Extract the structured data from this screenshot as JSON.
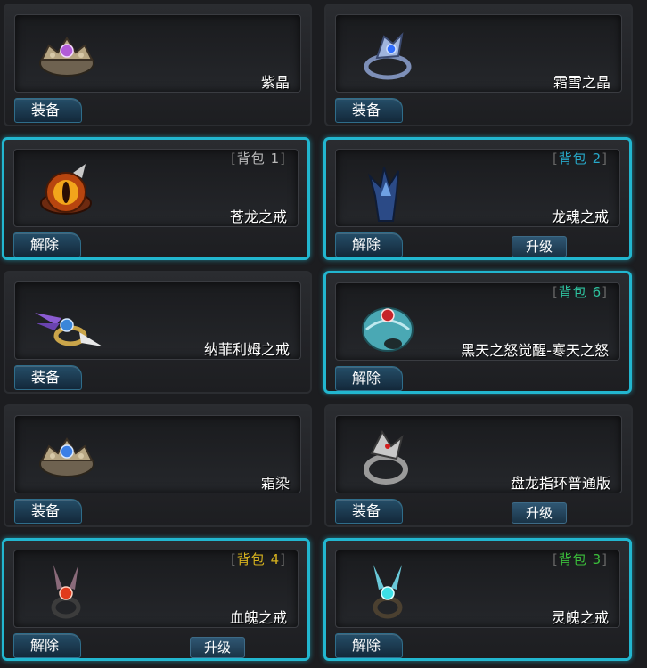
{
  "items": [
    {
      "name": "紫晶",
      "button": "装备",
      "selected": false,
      "bag": null,
      "upgrade": null,
      "icon": "crown-ring-purple-icon"
    },
    {
      "name": "霜雪之晶",
      "button": "装备",
      "selected": false,
      "bag": null,
      "upgrade": null,
      "icon": "frost-ring-icon"
    },
    {
      "name": "苍龙之戒",
      "button": "解除",
      "selected": true,
      "bag": {
        "label": "背包",
        "num": "1",
        "color": "#b8b8b8"
      },
      "upgrade": null,
      "icon": "dragon-eye-ring-icon"
    },
    {
      "name": "龙魂之戒",
      "button": "解除",
      "selected": true,
      "bag": {
        "label": "背包",
        "num": "2",
        "color": "#27a9c9"
      },
      "upgrade": "升级",
      "icon": "blue-claw-ring-icon"
    },
    {
      "name": "纳菲利姆之戒",
      "button": "装备",
      "selected": false,
      "bag": null,
      "upgrade": null,
      "icon": "winged-ring-icon"
    },
    {
      "name": "黑天之怒觉醒-寒天之怒",
      "button": "解除",
      "selected": true,
      "bag": {
        "label": "背包",
        "num": "6",
        "color": "#2ec4a0"
      },
      "upgrade": null,
      "icon": "ice-orb-ring-icon"
    },
    {
      "name": "霜染",
      "button": "装备",
      "selected": false,
      "bag": null,
      "upgrade": null,
      "icon": "crown-ring-blue-icon"
    },
    {
      "name": "盘龙指环普通版",
      "button": "装备",
      "selected": false,
      "bag": null,
      "upgrade": "升级",
      "icon": "silver-dragon-ring-icon"
    },
    {
      "name": "血魄之戒",
      "button": "解除",
      "selected": true,
      "bag": {
        "label": "背包",
        "num": "4",
        "color": "#d6b21e"
      },
      "upgrade": "升级",
      "icon": "red-gem-ring-icon"
    },
    {
      "name": "灵魄之戒",
      "button": "解除",
      "selected": true,
      "bag": {
        "label": "背包",
        "num": "3",
        "color": "#3bbf3b"
      },
      "upgrade": null,
      "icon": "cyan-gem-ring-icon"
    }
  ]
}
